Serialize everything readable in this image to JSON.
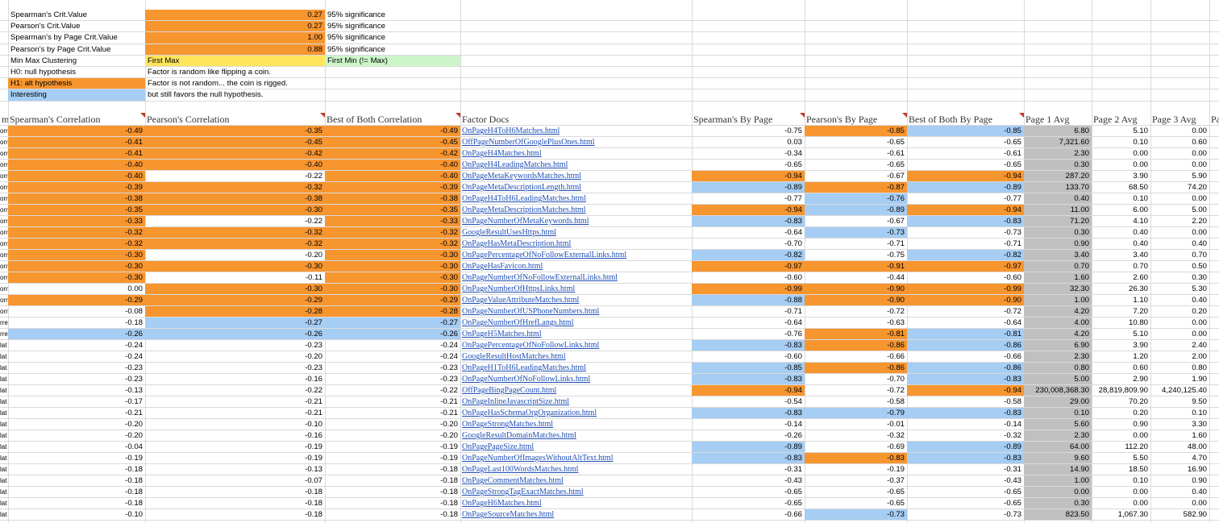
{
  "info_rows": [
    {
      "label": "Spearman's Crit.Value",
      "value": "0.27",
      "note": "95% significance"
    },
    {
      "label": "Pearson's Crit.Value",
      "value": "0.27",
      "note": "95% significance"
    },
    {
      "label": "Spearman's by Page Crit.Value",
      "value": "1.00",
      "note": "95% significance"
    },
    {
      "label": "Pearson's by Page Crit.Value",
      "value": "0.88",
      "note": "95% significance"
    },
    {
      "label": "Min Max Clustering",
      "value": "First Max",
      "note": "First Min (!= Max)"
    },
    {
      "label": "H0: null hypothesis",
      "value": "Factor is random like flipping a coin.",
      "note": ""
    },
    {
      "label": "H1: alt hypothesis",
      "value": "Factor is not random... the coin is rigged.",
      "note": ""
    },
    {
      "label": "Interesting",
      "value": "but still favors the null hypothesis.",
      "note": ""
    }
  ],
  "headers": {
    "col_a": "m",
    "spearman": "Spearman's Correlation",
    "pearson": "Pearson's Correlation",
    "best": "Best of Both Correlation",
    "factor": "Factor Docs",
    "sp_page": "Spearman's By Page",
    "pe_page": "Pearson's By Page",
    "best_page": "Best of Both By Page",
    "p1": "Page 1 Avg",
    "p2": "Page 2 Avg",
    "p3": "Page 3 Avg",
    "p4": "Pa"
  },
  "colors": {
    "orange": "#f7952f",
    "blue": "#a6cdf3",
    "gray": "#c0c0c0",
    "yellow": "#ffe55c",
    "green": "#ccf6c9"
  },
  "rows": [
    {
      "a": "orr",
      "sp": "-0.49",
      "pe": "-0.35",
      "best": "-0.49",
      "factor": "OnPageH4ToH6Matches.html",
      "spp": "-0.75",
      "pep": "-0.85",
      "bp": "-0.85",
      "p1": "6.80",
      "p2": "5.10",
      "p3": "0.00",
      "c": [
        "o",
        "o",
        "o",
        "",
        "",
        "o",
        "b"
      ]
    },
    {
      "a": "orr",
      "sp": "-0.41",
      "pe": "-0.45",
      "best": "-0.45",
      "factor": "OffPageNumberOfGooglePlusOnes.html",
      "spp": "0.03",
      "pep": "-0.65",
      "bp": "-0.65",
      "p1": "7,321.60",
      "p2": "0.10",
      "p3": "0.60",
      "c": [
        "o",
        "o",
        "o",
        "",
        "",
        "",
        ""
      ]
    },
    {
      "a": "orr",
      "sp": "-0.41",
      "pe": "-0.42",
      "best": "-0.42",
      "factor": "OnPageH4Matches.html",
      "spp": "-0.34",
      "pep": "-0.61",
      "bp": "-0.61",
      "p1": "2.30",
      "p2": "0.00",
      "p3": "0.00",
      "c": [
        "o",
        "o",
        "o",
        "",
        "",
        "",
        ""
      ]
    },
    {
      "a": "orr",
      "sp": "-0.40",
      "pe": "-0.40",
      "best": "-0.40",
      "factor": "OnPageH4LeadingMatches.html",
      "spp": "-0.65",
      "pep": "-0.65",
      "bp": "-0.65",
      "p1": "0.30",
      "p2": "0.00",
      "p3": "0.00",
      "c": [
        "o",
        "o",
        "o",
        "",
        "",
        "",
        ""
      ]
    },
    {
      "a": "orr",
      "sp": "-0.40",
      "pe": "-0.22",
      "best": "-0.40",
      "factor": "OnPageMetaKeywordsMatches.html",
      "spp": "-0.94",
      "pep": "-0.67",
      "bp": "-0.94",
      "p1": "287.20",
      "p2": "3.90",
      "p3": "5.90",
      "c": [
        "o",
        "",
        "o",
        "",
        "o",
        "",
        "o"
      ]
    },
    {
      "a": "orr",
      "sp": "-0.39",
      "pe": "-0.32",
      "best": "-0.39",
      "factor": "OnPageMetaDescriptionLength.html",
      "spp": "-0.89",
      "pep": "-0.87",
      "bp": "-0.89",
      "p1": "133.70",
      "p2": "68.50",
      "p3": "74.20",
      "c": [
        "o",
        "o",
        "o",
        "",
        "b",
        "o",
        "b"
      ]
    },
    {
      "a": "orr",
      "sp": "-0.38",
      "pe": "-0.38",
      "best": "-0.38",
      "factor": "OnPageH4ToH6LeadingMatches.html",
      "spp": "-0.77",
      "pep": "-0.76",
      "bp": "-0.77",
      "p1": "0.40",
      "p2": "0.10",
      "p3": "0.00",
      "c": [
        "o",
        "o",
        "o",
        "",
        "",
        "b",
        ""
      ]
    },
    {
      "a": "orr",
      "sp": "-0.35",
      "pe": "-0.30",
      "best": "-0.35",
      "factor": "OnPageMetaDescriptionMatches.html",
      "spp": "-0.94",
      "pep": "-0.89",
      "bp": "-0.94",
      "p1": "11.00",
      "p2": "6.00",
      "p3": "5.00",
      "c": [
        "o",
        "o",
        "o",
        "",
        "o",
        "b",
        "o"
      ]
    },
    {
      "a": "orr",
      "sp": "-0.33",
      "pe": "-0.22",
      "best": "-0.33",
      "factor": "OnPageNumberOfMetaKeywords.html",
      "spp": "-0.83",
      "pep": "-0.67",
      "bp": "-0.83",
      "p1": "71.20",
      "p2": "4.10",
      "p3": "2.20",
      "c": [
        "o",
        "",
        "o",
        "",
        "b",
        "",
        "b"
      ]
    },
    {
      "a": "orr",
      "sp": "-0.32",
      "pe": "-0.32",
      "best": "-0.32",
      "factor": "GoogleResultUsesHttps.html",
      "spp": "-0.64",
      "pep": "-0.73",
      "bp": "-0.73",
      "p1": "0.30",
      "p2": "0.40",
      "p3": "0.00",
      "c": [
        "o",
        "o",
        "o",
        "",
        "",
        "b",
        ""
      ]
    },
    {
      "a": "orr",
      "sp": "-0.32",
      "pe": "-0.32",
      "best": "-0.32",
      "factor": "OnPageHasMetaDescription.html",
      "spp": "-0.70",
      "pep": "-0.71",
      "bp": "-0.71",
      "p1": "0.90",
      "p2": "0.40",
      "p3": "0.40",
      "c": [
        "o",
        "o",
        "o",
        "",
        "",
        "",
        ""
      ]
    },
    {
      "a": "orr",
      "sp": "-0.30",
      "pe": "-0.20",
      "best": "-0.30",
      "factor": "OnPagePercentageOfNoFollowExternalLinks.html",
      "spp": "-0.82",
      "pep": "-0.75",
      "bp": "-0.82",
      "p1": "3.40",
      "p2": "3.40",
      "p3": "0.70",
      "c": [
        "o",
        "",
        "o",
        "",
        "b",
        "",
        "b"
      ]
    },
    {
      "a": "orr",
      "sp": "-0.30",
      "pe": "-0.30",
      "best": "-0.30",
      "factor": "OnPageHasFavicon.html",
      "spp": "-0.97",
      "pep": "-0.91",
      "bp": "-0.97",
      "p1": "0.70",
      "p2": "0.70",
      "p3": "0.50",
      "c": [
        "o",
        "o",
        "o",
        "",
        "o",
        "o",
        "o"
      ]
    },
    {
      "a": "orr",
      "sp": "-0.30",
      "pe": "-0.11",
      "best": "-0.30",
      "factor": "OnPageNumberOfNoFollowExternalLinks.html",
      "spp": "-0.60",
      "pep": "-0.44",
      "bp": "-0.60",
      "p1": "1.60",
      "p2": "2.60",
      "p3": "0.30",
      "c": [
        "o",
        "",
        "o",
        "",
        "",
        "",
        ""
      ]
    },
    {
      "a": "orr",
      "sp": "0.00",
      "pe": "-0.30",
      "best": "-0.30",
      "factor": "OnPageNumberOfHttpsLinks.html",
      "spp": "-0.99",
      "pep": "-0.90",
      "bp": "-0.99",
      "p1": "32.30",
      "p2": "26.30",
      "p3": "5.30",
      "c": [
        "",
        "o",
        "o",
        "",
        "o",
        "o",
        "o"
      ]
    },
    {
      "a": "orr",
      "sp": "-0.29",
      "pe": "-0.29",
      "best": "-0.29",
      "factor": "OnPageValueAttributeMatches.html",
      "spp": "-0.88",
      "pep": "-0.90",
      "bp": "-0.90",
      "p1": "1.00",
      "p2": "1.10",
      "p3": "0.40",
      "c": [
        "o",
        "o",
        "o",
        "",
        "b",
        "o",
        "o"
      ]
    },
    {
      "a": "orr",
      "sp": "-0.08",
      "pe": "-0.28",
      "best": "-0.28",
      "factor": "OnPageNumberOfUSPhoneNumbers.html",
      "spp": "-0.71",
      "pep": "-0.72",
      "bp": "-0.72",
      "p1": "4.20",
      "p2": "7.20",
      "p3": "0.20",
      "c": [
        "",
        "o",
        "o",
        "",
        "",
        "",
        ""
      ]
    },
    {
      "a": "rre",
      "sp": "-0.18",
      "pe": "-0.27",
      "best": "-0.27",
      "factor": "OnPageNumberOfHrefLangs.html",
      "spp": "-0.64",
      "pep": "-0.63",
      "bp": "-0.64",
      "p1": "4.00",
      "p2": "10.80",
      "p3": "0.00",
      "c": [
        "",
        "b",
        "b",
        "",
        "",
        "",
        ""
      ]
    },
    {
      "a": "rre",
      "sp": "-0.26",
      "pe": "-0.26",
      "best": "-0.26",
      "factor": "OnPageH5Matches.html",
      "spp": "-0.76",
      "pep": "-0.81",
      "bp": "-0.81",
      "p1": "4.20",
      "p2": "5.10",
      "p3": "0.00",
      "c": [
        "b",
        "b",
        "b",
        "",
        "",
        "o",
        "b"
      ]
    },
    {
      "a": "lat",
      "sp": "-0.24",
      "pe": "-0.23",
      "best": "-0.24",
      "factor": "OnPagePercentageOfNoFollowLinks.html",
      "spp": "-0.83",
      "pep": "-0.86",
      "bp": "-0.86",
      "p1": "6.90",
      "p2": "3.90",
      "p3": "2.40",
      "c": [
        "",
        "",
        "",
        "",
        "b",
        "o",
        "b"
      ]
    },
    {
      "a": "lat",
      "sp": "-0.24",
      "pe": "-0.20",
      "best": "-0.24",
      "factor": "GoogleResultHostMatches.html",
      "spp": "-0.60",
      "pep": "-0.66",
      "bp": "-0.66",
      "p1": "2.30",
      "p2": "1.20",
      "p3": "2.00",
      "c": [
        "",
        "",
        "",
        "",
        "",
        "",
        ""
      ]
    },
    {
      "a": "lat",
      "sp": "-0.23",
      "pe": "-0.23",
      "best": "-0.23",
      "factor": "OnPageH1ToH6LeadingMatches.html",
      "spp": "-0.85",
      "pep": "-0.86",
      "bp": "-0.86",
      "p1": "0.80",
      "p2": "0.60",
      "p3": "0.80",
      "c": [
        "",
        "",
        "",
        "",
        "b",
        "o",
        "b"
      ]
    },
    {
      "a": "lat",
      "sp": "-0.23",
      "pe": "-0.16",
      "best": "-0.23",
      "factor": "OnPageNumberOfNoFollowLinks.html",
      "spp": "-0.83",
      "pep": "-0.70",
      "bp": "-0.83",
      "p1": "5.00",
      "p2": "2.90",
      "p3": "1.90",
      "c": [
        "",
        "",
        "",
        "",
        "b",
        "",
        "b"
      ]
    },
    {
      "a": "lat",
      "sp": "-0.13",
      "pe": "-0.22",
      "best": "-0.22",
      "factor": "OffPageBingPageCount.html",
      "spp": "-0.94",
      "pep": "-0.72",
      "bp": "-0.94",
      "p1": "230,008,368.30",
      "p2": "28,819,809.90",
      "p3": "4,240,125.40",
      "c": [
        "",
        "",
        "",
        "",
        "o",
        "",
        "o"
      ]
    },
    {
      "a": "lat",
      "sp": "-0.17",
      "pe": "-0.21",
      "best": "-0.21",
      "factor": "OnPageInlineJavascriptSize.html",
      "spp": "-0.54",
      "pep": "-0.58",
      "bp": "-0.58",
      "p1": "29.00",
      "p2": "70.20",
      "p3": "9.50",
      "c": [
        "",
        "",
        "",
        "",
        "",
        "",
        ""
      ]
    },
    {
      "a": "lat",
      "sp": "-0.21",
      "pe": "-0.21",
      "best": "-0.21",
      "factor": "OnPageHasSchemaOrgOrganization.html",
      "spp": "-0.83",
      "pep": "-0.79",
      "bp": "-0.83",
      "p1": "0.10",
      "p2": "0.20",
      "p3": "0.10",
      "c": [
        "",
        "",
        "",
        "",
        "b",
        "b",
        "b"
      ]
    },
    {
      "a": "lat",
      "sp": "-0.20",
      "pe": "-0.10",
      "best": "-0.20",
      "factor": "OnPageStrongMatches.html",
      "spp": "-0.14",
      "pep": "-0.01",
      "bp": "-0.14",
      "p1": "5.60",
      "p2": "0.90",
      "p3": "3.30",
      "c": [
        "",
        "",
        "",
        "",
        "",
        "",
        ""
      ]
    },
    {
      "a": "lat",
      "sp": "-0.20",
      "pe": "-0.16",
      "best": "-0.20",
      "factor": "GoogleResultDomainMatches.html",
      "spp": "-0.26",
      "pep": "-0.32",
      "bp": "-0.32",
      "p1": "2.30",
      "p2": "0.00",
      "p3": "1.60",
      "c": [
        "",
        "",
        "",
        "",
        "",
        "",
        ""
      ]
    },
    {
      "a": "lat",
      "sp": "-0.04",
      "pe": "-0.19",
      "best": "-0.19",
      "factor": "OnPagePageSize.html",
      "spp": "-0.89",
      "pep": "-0.69",
      "bp": "-0.89",
      "p1": "64.00",
      "p2": "112.20",
      "p3": "48.00",
      "c": [
        "",
        "",
        "",
        "",
        "b",
        "",
        "b"
      ]
    },
    {
      "a": "lat",
      "sp": "-0.19",
      "pe": "-0.19",
      "best": "-0.19",
      "factor": "OnPageNumberOfImagesWithoutAltText.html",
      "spp": "-0.83",
      "pep": "-0.83",
      "bp": "-0.83",
      "p1": "9.60",
      "p2": "5.50",
      "p3": "4.70",
      "c": [
        "",
        "",
        "",
        "",
        "b",
        "o",
        "b"
      ]
    },
    {
      "a": "lat",
      "sp": "-0.18",
      "pe": "-0.13",
      "best": "-0.18",
      "factor": "OnPageLast100WordsMatches.html",
      "spp": "-0.31",
      "pep": "-0.19",
      "bp": "-0.31",
      "p1": "14.90",
      "p2": "18.50",
      "p3": "16.90",
      "c": [
        "",
        "",
        "",
        "",
        "",
        "",
        ""
      ]
    },
    {
      "a": "lat",
      "sp": "-0.18",
      "pe": "-0.07",
      "best": "-0.18",
      "factor": "OnPageCommentMatches.html",
      "spp": "-0.43",
      "pep": "-0.37",
      "bp": "-0.43",
      "p1": "1.00",
      "p2": "0.10",
      "p3": "0.90",
      "c": [
        "",
        "",
        "",
        "",
        "",
        "",
        ""
      ]
    },
    {
      "a": "lat",
      "sp": "-0.18",
      "pe": "-0.18",
      "best": "-0.18",
      "factor": "OnPageStrongTagExactMatches.html",
      "spp": "-0.65",
      "pep": "-0.65",
      "bp": "-0.65",
      "p1": "0.00",
      "p2": "0.00",
      "p3": "0.40",
      "c": [
        "",
        "",
        "",
        "",
        "",
        "",
        ""
      ]
    },
    {
      "a": "lat",
      "sp": "-0.18",
      "pe": "-0.18",
      "best": "-0.18",
      "factor": "OnPageH6Matches.html",
      "spp": "-0.65",
      "pep": "-0.65",
      "bp": "-0.65",
      "p1": "0.30",
      "p2": "0.00",
      "p3": "0.00",
      "c": [
        "",
        "",
        "",
        "",
        "",
        "",
        ""
      ]
    },
    {
      "a": "lat",
      "sp": "-0.10",
      "pe": "-0.18",
      "best": "-0.18",
      "factor": "OnPageSourceMatches.html",
      "spp": "-0.66",
      "pep": "-0.73",
      "bp": "-0.73",
      "p1": "823.50",
      "p2": "1,067.30",
      "p3": "582.90",
      "c": [
        "",
        "",
        "",
        "",
        "",
        "b",
        ""
      ]
    }
  ]
}
